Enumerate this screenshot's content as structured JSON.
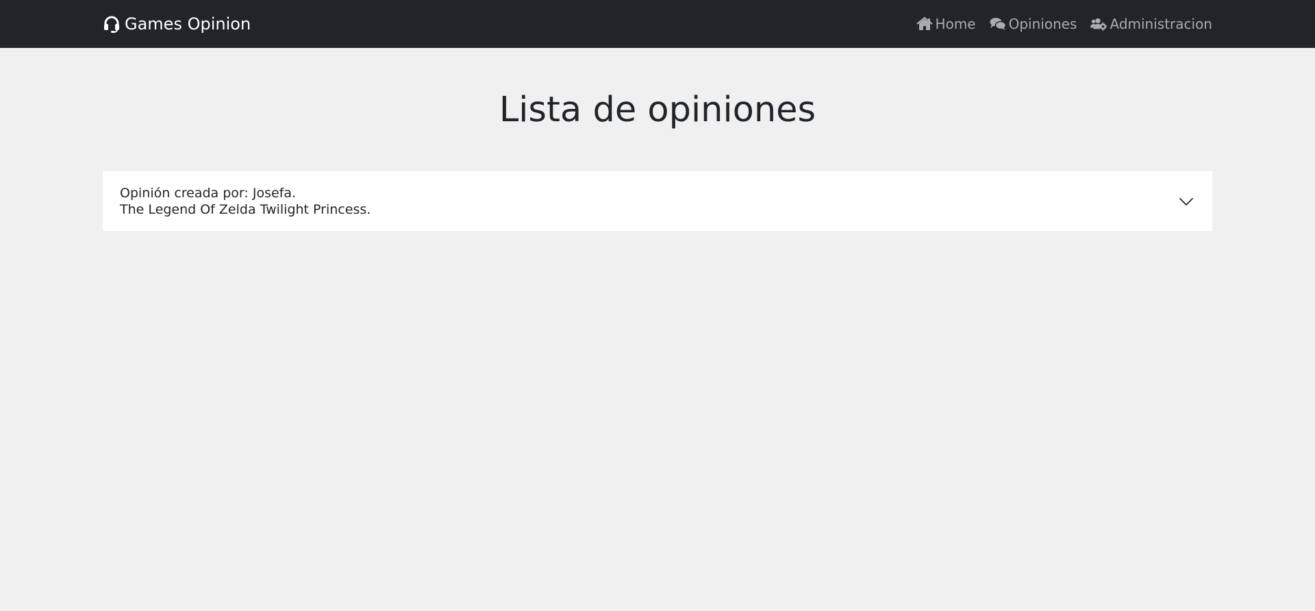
{
  "navbar": {
    "brand": {
      "label": "Games Opinion",
      "icon": "headset-icon"
    },
    "items": [
      {
        "label": "Home",
        "icon": "home-icon"
      },
      {
        "label": "Opiniones",
        "icon": "comments-icon"
      },
      {
        "label": "Administracion",
        "icon": "users-cog-icon"
      }
    ]
  },
  "main": {
    "title": "Lista de opiniones",
    "opinions": [
      {
        "author_line": "Opinión creada por: Josefa.",
        "game_line": "The Legend Of Zelda Twilight Princess."
      }
    ]
  },
  "colors": {
    "navbar_bg": "#212529",
    "page_bg": "#f0f0f0",
    "nav_text": "#a9acaf",
    "brand_text": "#ffffff"
  }
}
